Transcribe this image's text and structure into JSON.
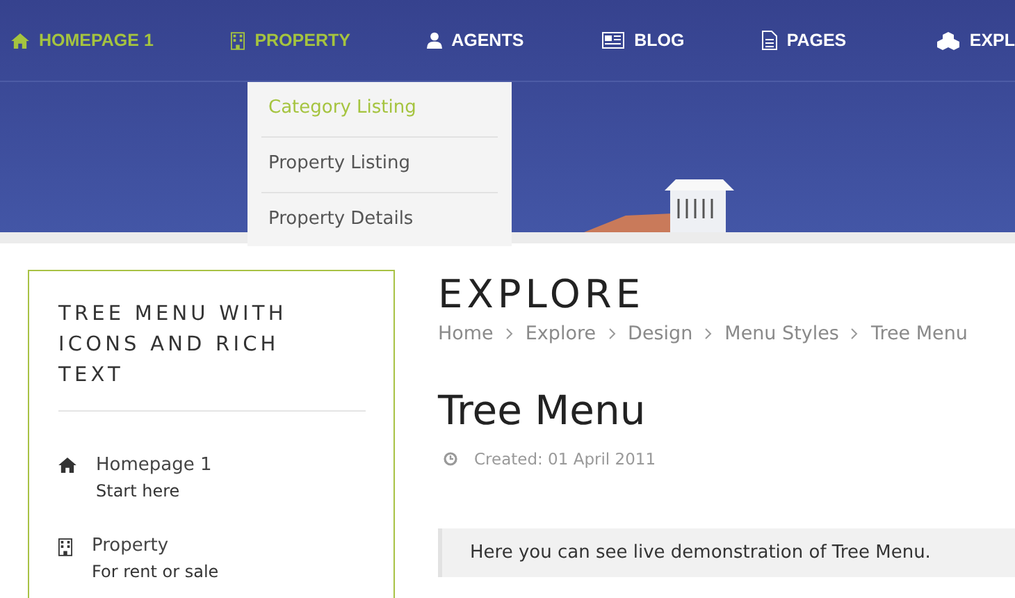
{
  "nav": {
    "items": [
      {
        "label": "HOMEPAGE 1",
        "kind": "home",
        "highlighted": true
      },
      {
        "label": "PROPERTY",
        "kind": "building",
        "highlighted": true
      },
      {
        "label": "AGENTS",
        "kind": "user",
        "highlighted": false
      },
      {
        "label": "BLOG",
        "kind": "newspaper",
        "highlighted": false
      },
      {
        "label": "PAGES",
        "kind": "document",
        "highlighted": false
      },
      {
        "label": "EXPL",
        "kind": "cubes",
        "highlighted": false
      }
    ]
  },
  "dropdown": {
    "items": [
      {
        "label": "Category Listing",
        "selected": true
      },
      {
        "label": "Property Listing",
        "selected": false
      },
      {
        "label": "Property Details",
        "selected": false
      }
    ]
  },
  "sidebar": {
    "title": "TREE MENU WITH ICONS AND RICH TEXT",
    "items": [
      {
        "label": "Homepage 1",
        "subtitle": "Start here",
        "kind": "home"
      },
      {
        "label": "Property",
        "subtitle": "For rent or sale",
        "kind": "building"
      }
    ]
  },
  "page": {
    "heading": "EXPLORE",
    "breadcrumb": [
      "Home",
      "Explore",
      "Design",
      "Menu Styles",
      "Tree Menu"
    ],
    "title": "Tree Menu",
    "created": "Created: 01 April 2011",
    "notice": "Here you can see live demonstration of Tree Menu."
  }
}
